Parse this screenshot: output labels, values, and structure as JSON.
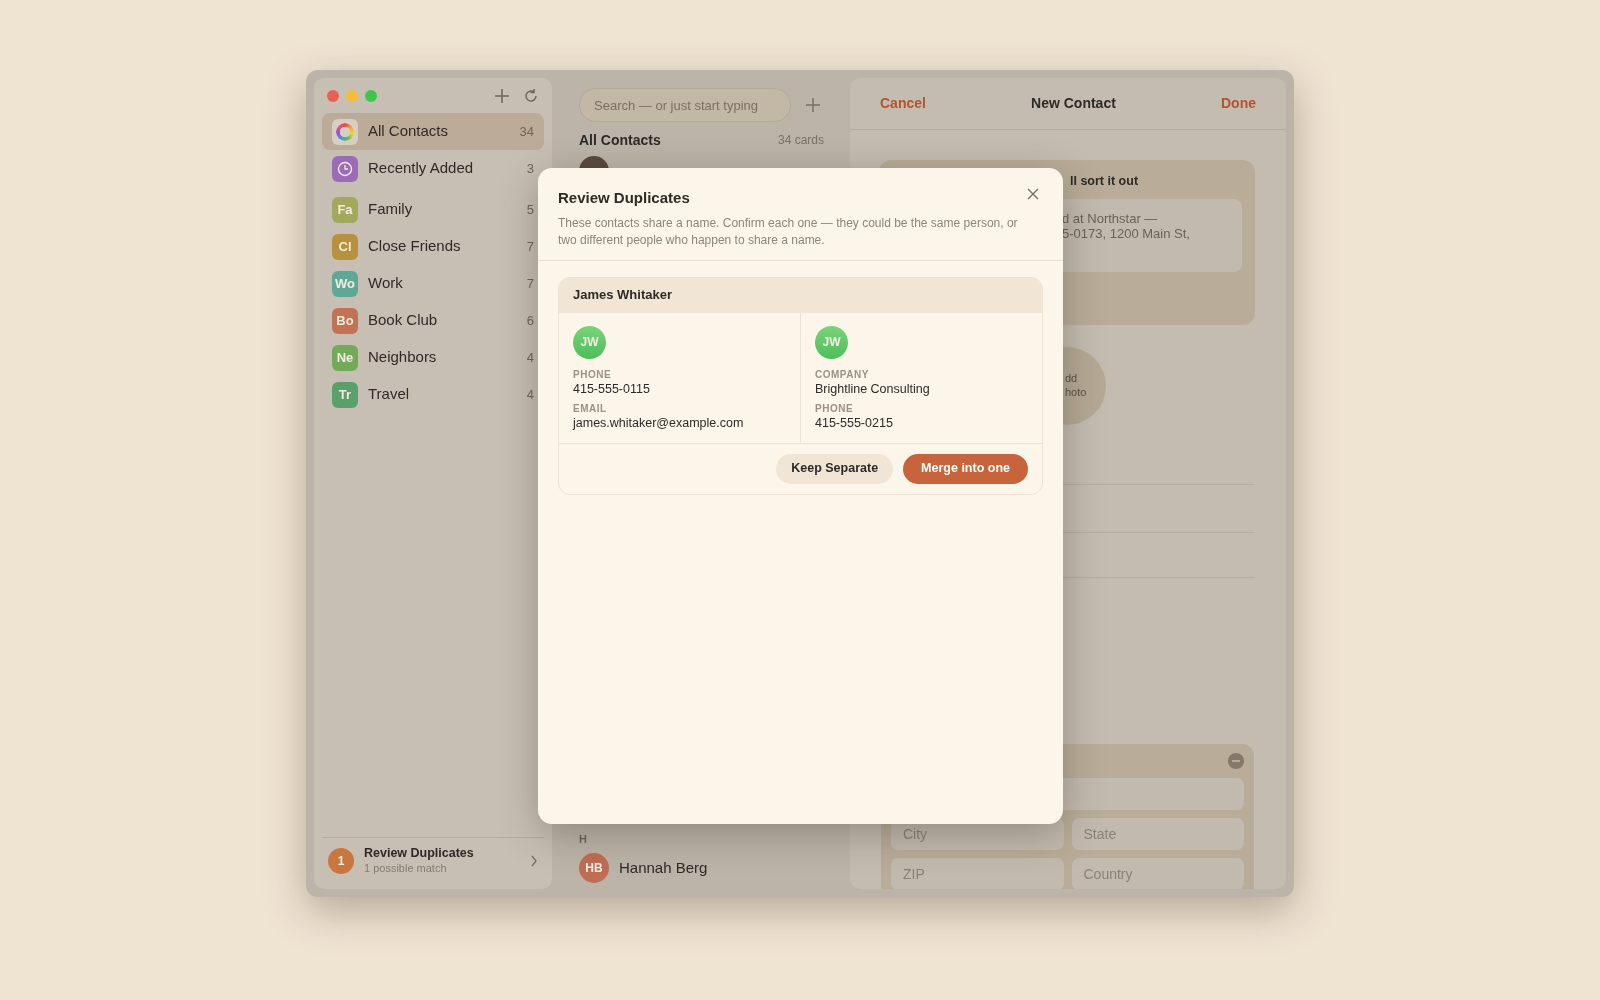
{
  "sidebar": {
    "groups": [
      {
        "label": "All Contacts",
        "count": "34",
        "kind": "ring",
        "selected": true
      },
      {
        "label": "Recently Added",
        "count": "3",
        "kind": "clock",
        "color": "#9a6cb8",
        "selected": false
      },
      {
        "label": "Family",
        "count": "5",
        "kind": "initials",
        "initials": "Fa",
        "color": "#a2a85c",
        "selected": false
      },
      {
        "label": "Close Friends",
        "count": "7",
        "kind": "initials",
        "initials": "Cl",
        "color": "#b8913f",
        "selected": false
      },
      {
        "label": "Work",
        "count": "7",
        "kind": "initials",
        "initials": "Wo",
        "color": "#5fa898",
        "selected": false
      },
      {
        "label": "Book Club",
        "count": "6",
        "kind": "initials",
        "initials": "Bo",
        "color": "#c27353",
        "selected": false
      },
      {
        "label": "Neighbors",
        "count": "4",
        "kind": "initials",
        "initials": "Ne",
        "color": "#72aa5a",
        "selected": false
      },
      {
        "label": "Travel",
        "count": "4",
        "kind": "initials",
        "initials": "Tr",
        "color": "#5aa06a",
        "selected": false
      }
    ],
    "duplicates": {
      "badge": "1",
      "title": "Review Duplicates",
      "subtitle": "1 possible match"
    }
  },
  "list": {
    "search": {
      "placeholder": "Search — or just start typing"
    },
    "heading": "All Contacts",
    "count": "34 cards",
    "sections": [
      {
        "letter": "H",
        "contacts": [
          {
            "name": "Hannah Berg",
            "initials": "HB"
          }
        ]
      }
    ]
  },
  "editor": {
    "cancel": "Cancel",
    "title": "New Contact",
    "done": "Done",
    "note_card": {
      "title": "ll sort it out",
      "lines": [
        "d at Northstar —",
        "5-0173, 1200 Main St,"
      ]
    },
    "photo": {
      "lines": [
        "dd",
        "hoto"
      ]
    },
    "address": {
      "fields": [
        {
          "placeholder": "City"
        },
        {
          "placeholder": "State"
        },
        {
          "placeholder": "ZIP"
        },
        {
          "placeholder": "Country"
        }
      ]
    }
  },
  "modal": {
    "title": "Review Duplicates",
    "description": "These contacts share a name. Confirm each one — they could be the same person, or two different people who happen to share a name.",
    "groups": [
      {
        "name": "James Whitaker",
        "cards": [
          {
            "initials": "JW",
            "fields": [
              {
                "label": "PHONE",
                "value": "415-555-0115"
              },
              {
                "label": "EMAIL",
                "value": "james.whitaker@example.com"
              }
            ]
          },
          {
            "initials": "JW",
            "fields": [
              {
                "label": "COMPANY",
                "value": "Brightline Consulting"
              },
              {
                "label": "PHONE",
                "value": "415-555-0215"
              }
            ]
          }
        ],
        "actions": [
          {
            "label": "Keep Separate",
            "kind": "secondary"
          },
          {
            "label": "Merge into one",
            "kind": "primary"
          }
        ]
      }
    ]
  }
}
